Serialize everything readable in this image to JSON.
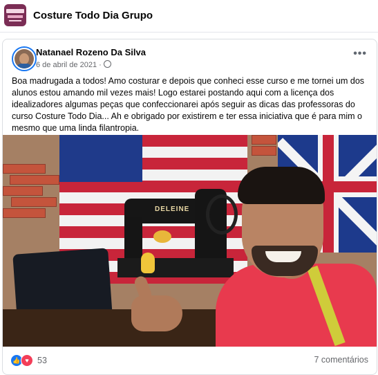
{
  "group": {
    "name": "Costure Todo Dia Grupo",
    "logo_icon": "group-logo-icon"
  },
  "post": {
    "author": "Natanael Rozeno Da Silva",
    "date": "6 de abril de 2021",
    "separator": "·",
    "privacy_icon": "globe-icon",
    "more_label": "•••",
    "text": "Boa madrugada a todos! Amo costurar e depois que conheci esse curso e me tornei um dos alunos estou amando mil vezes mais! Logo estarei postando aqui com a licença dos idealizadores algumas peças que confeccionarei após seguir as dicas das professoras do curso Costure Todo Dia... Ah e obrigado por existirem e ter essa iniciativa que é para mim o mesmo que uma linda filantropia.",
    "photo": {
      "machine_brand": "DELEINE"
    },
    "reactions": {
      "like_icon": "like-icon",
      "love_icon": "love-icon",
      "like_glyph": "👍",
      "love_glyph": "♥",
      "count": "53"
    },
    "comments_label": "7 comentários"
  },
  "colors": {
    "accent": "#1877f2",
    "love": "#f33e58",
    "secondary_text": "#65676b",
    "group_logo": "#7b2d55"
  }
}
